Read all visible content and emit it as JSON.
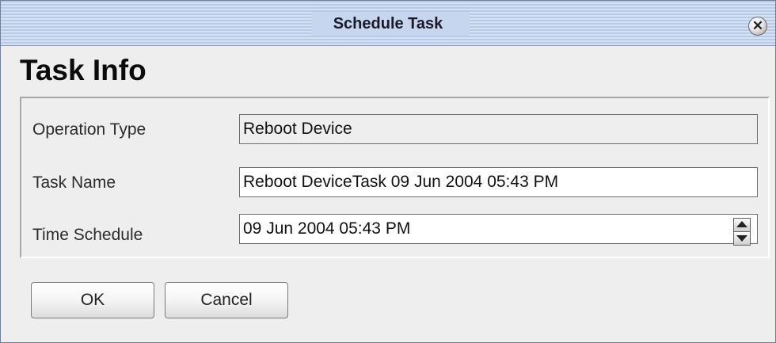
{
  "window": {
    "title": "Schedule Task",
    "close_glyph": "✕"
  },
  "section_heading": "Task Info",
  "form": {
    "operation_type": {
      "label": "Operation Type",
      "value": "Reboot Device"
    },
    "task_name": {
      "label": "Task Name",
      "value": "Reboot DeviceTask 09 Jun 2004 05:43 PM"
    },
    "time_schedule": {
      "label": "Time Schedule",
      "value": "09 Jun 2004 05:43 PM"
    }
  },
  "buttons": {
    "ok_label": "OK",
    "cancel_label": "Cancel"
  },
  "icons": {
    "close": "close-icon",
    "spin_up": "spin-up-icon",
    "spin_down": "spin-down-icon"
  },
  "colors": {
    "titlebar": "#b8cbe6",
    "background": "#eeeeee"
  }
}
